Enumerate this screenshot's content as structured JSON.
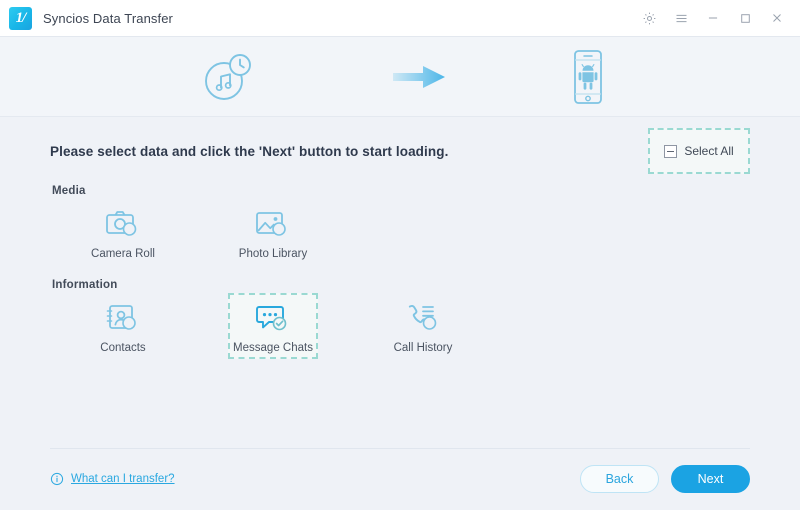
{
  "window": {
    "title": "Syncios Data Transfer",
    "logo_mark": "1/",
    "controls": [
      {
        "name": "settings",
        "icon": "gear-icon"
      },
      {
        "name": "menu",
        "icon": "hamburger-menu-icon"
      },
      {
        "name": "minimize",
        "icon": "minimize-icon"
      },
      {
        "name": "maximize",
        "icon": "maximize-icon"
      },
      {
        "name": "close",
        "icon": "close-icon"
      }
    ]
  },
  "steps": {
    "source": {
      "icon": "itunes-backup-music-clock-icon",
      "label": ""
    },
    "arrow": {
      "icon": "arrow-right-icon"
    },
    "destination": {
      "icon": "android-phone-icon",
      "label": ""
    }
  },
  "content": {
    "headline": "Please select data and click the 'Next' button to start loading.",
    "select_all": {
      "label": "Select All",
      "checkbox_state": "indeterminate",
      "selected": true
    },
    "groups": [
      {
        "title": "Media",
        "items": [
          {
            "label": "Camera Roll",
            "icon": "camera-icon",
            "selected": false
          },
          {
            "label": "Photo Library",
            "icon": "photo-library-icon",
            "selected": false
          }
        ]
      },
      {
        "title": "Information",
        "items": [
          {
            "label": "Contacts",
            "icon": "contacts-icon",
            "selected": false
          },
          {
            "label": "Message Chats",
            "icon": "message-chat-icon",
            "selected": true
          },
          {
            "label": "Call History",
            "icon": "call-history-icon",
            "selected": false
          }
        ]
      }
    ]
  },
  "footer": {
    "help_label": "What can I transfer?",
    "help_icon": "info-icon",
    "back_label": "Back",
    "next_label": "Next"
  },
  "colors": {
    "accent_blue": "#1ba3e3",
    "icon_blue": "#7ec4e3",
    "selection_teal": "#9ad9d2",
    "page_bg": "#eff2f7",
    "titlebar_bg": "#ffffff",
    "text_dark": "#2f3a4d"
  }
}
